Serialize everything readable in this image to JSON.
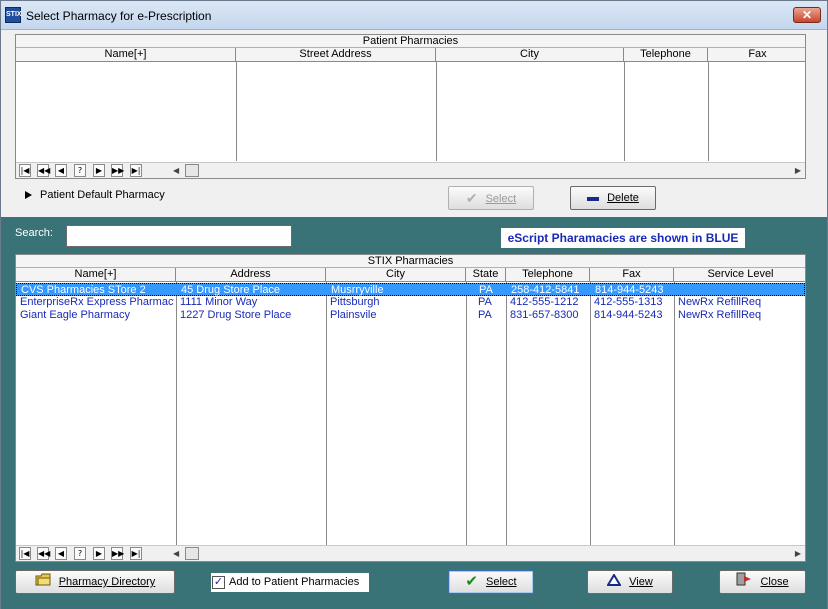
{
  "window": {
    "title": "Select Pharmacy for e-Prescription",
    "icon": "app-icon",
    "icon_text": "STIX",
    "close": "✕"
  },
  "patient_pharmacies": {
    "caption": "Patient Pharmacies",
    "columns": [
      "Name[+]",
      "Street Address",
      "City",
      "Telephone",
      "Fax"
    ],
    "rows": []
  },
  "navigator": [
    "|◀",
    "◀◀",
    "◀",
    "?",
    "▶",
    "▶▶",
    "▶|"
  ],
  "scroll": {
    "left": "◀",
    "right": "▶"
  },
  "default_pharmacy_label": "Patient Default Pharmacy",
  "top_buttons": {
    "select": "Select",
    "delete": "Delete"
  },
  "search": {
    "label": "Search:",
    "value": ""
  },
  "blue_note": "eScript Pharamacies are shown in BLUE",
  "stix_pharmacies": {
    "caption": "STIX Pharmacies",
    "columns": [
      "Name[+]",
      "Address",
      "City",
      "State",
      "Telephone",
      "Fax",
      "Service Level"
    ],
    "rows": [
      {
        "name": "CVS Pharmacies STore 2",
        "address": "45 Drug Store Place",
        "city": "Musrryville",
        "state": "PA",
        "telephone": "258-412-5841",
        "fax": "814-944-5243",
        "service": ""
      },
      {
        "name": "EnterpriseRx Express Pharmacy",
        "address": "1111 Minor Way",
        "city": "Pittsburgh",
        "state": "PA",
        "telephone": "412-555-1212",
        "fax": "412-555-1313",
        "service": "NewRx RefillReq"
      },
      {
        "name": "Giant Eagle Pharmacy",
        "address": "1227 Drug Store Place",
        "city": "Plainsvile",
        "state": "PA",
        "telephone": "831-657-8300",
        "fax": "814-944-5243",
        "service": "NewRx RefillReq"
      }
    ]
  },
  "bottom_buttons": {
    "pharmacy_directory": "Pharmacy Directory",
    "add_to_patient": "Add to Patient Pharmacies",
    "add_checked": true,
    "select": "Select",
    "view": "View",
    "close": "Close"
  },
  "colors": {
    "teal_panel": "#397377",
    "escript_blue": "#1a2ab5",
    "selection": "#3399ff"
  }
}
